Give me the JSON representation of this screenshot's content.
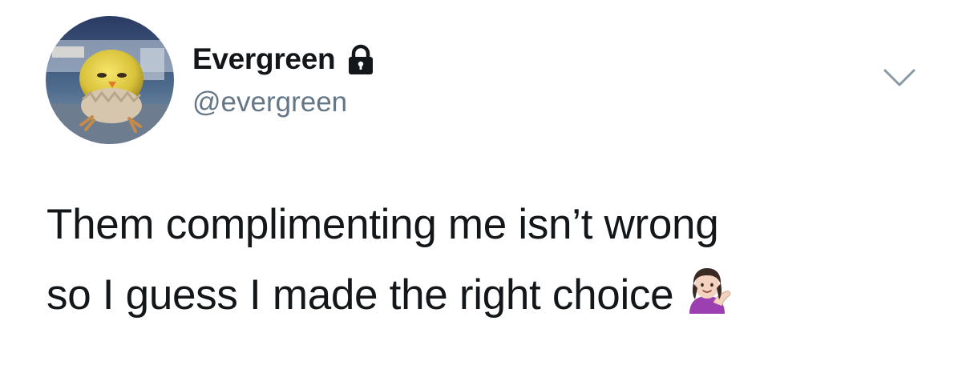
{
  "tweet": {
    "display_name": "Evergreen",
    "handle": "@evergreen",
    "protected_icon": "lock-icon",
    "caret_icon": "chevron-down-icon",
    "text_line_1": "Them complimenting me isn’t wrong",
    "text_line_2": "so I guess I made the right choice",
    "emoji": "woman-tipping-hand-emoji",
    "avatar_subject": "chick-in-eggshell-avatar"
  },
  "colors": {
    "text_primary": "#14171a",
    "text_secondary": "#657786",
    "caret": "#8899a6",
    "background": "#ffffff"
  }
}
